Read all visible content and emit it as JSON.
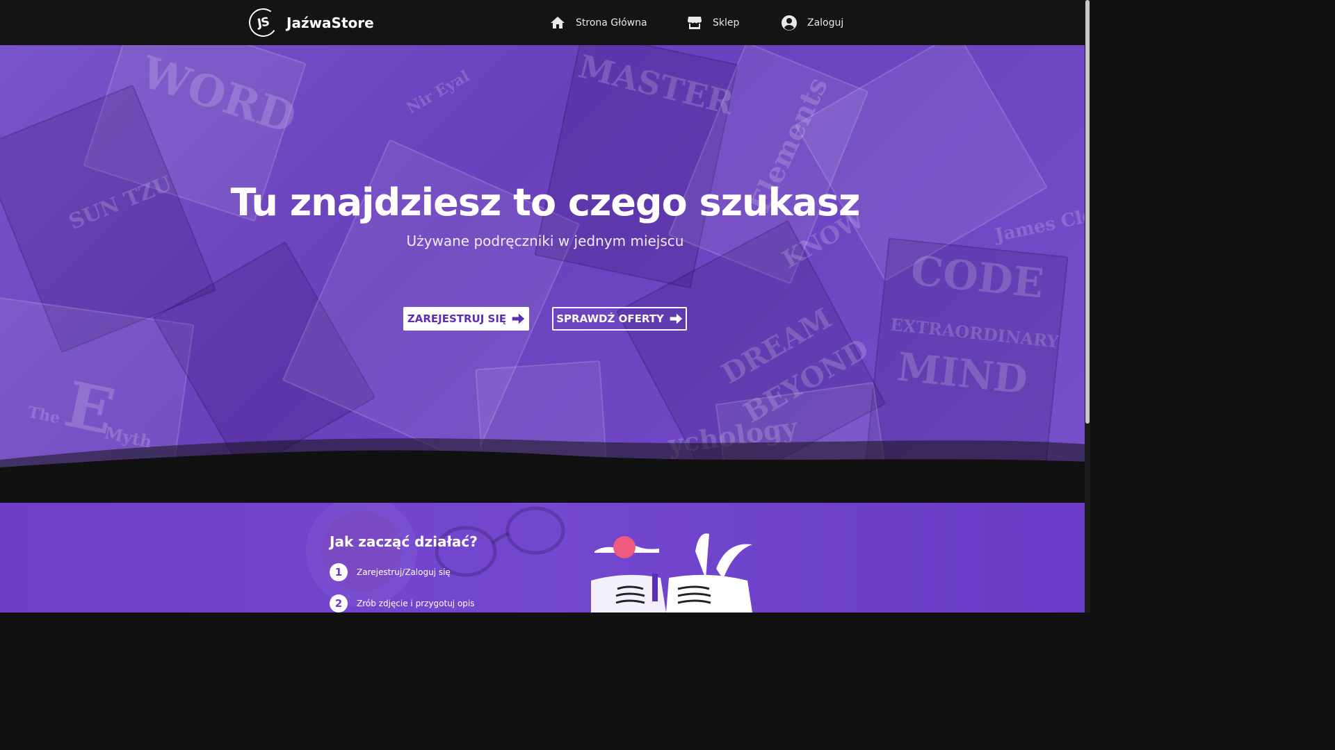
{
  "nav": {
    "logo_badge": "JS",
    "brand": "JaźwaStore",
    "items": [
      {
        "label": "Strona Główna",
        "icon": "home-icon"
      },
      {
        "label": "Sklep",
        "icon": "store-icon"
      },
      {
        "label": "Zaloguj",
        "icon": "user-circle-icon"
      }
    ]
  },
  "hero": {
    "title": "Tu znajdziesz to czego szukasz",
    "subtitle": "Używane podręczniki w jednym miejscu",
    "primary_button": "ZAREJESTRUJ SIĘ",
    "secondary_button": "SPRAWDŹ OFERTY",
    "book_texts": [
      "WORD",
      "SUN TZU",
      "MASTER",
      "Elements",
      "CODE",
      "EXTRAORDINARY",
      "MIND",
      "James Cle",
      "DREAM",
      "BEYOND",
      "KNOW",
      "Nir Eyal",
      "The",
      "E",
      "Myth",
      "ychology"
    ]
  },
  "how": {
    "title": "Jak zacząć działać?",
    "steps": [
      {
        "number": "1",
        "text": "Zarejestruj/Zaloguj się"
      },
      {
        "number": "2",
        "text": "Zrób zdjęcie i przygotuj opis"
      }
    ]
  },
  "colors": {
    "nav_bg": "#141414",
    "hero_purple": "#6f47c4",
    "button_text": "#5a2fb3",
    "section_purple": "#7447cf",
    "accent_sun": "#f05a7e"
  }
}
